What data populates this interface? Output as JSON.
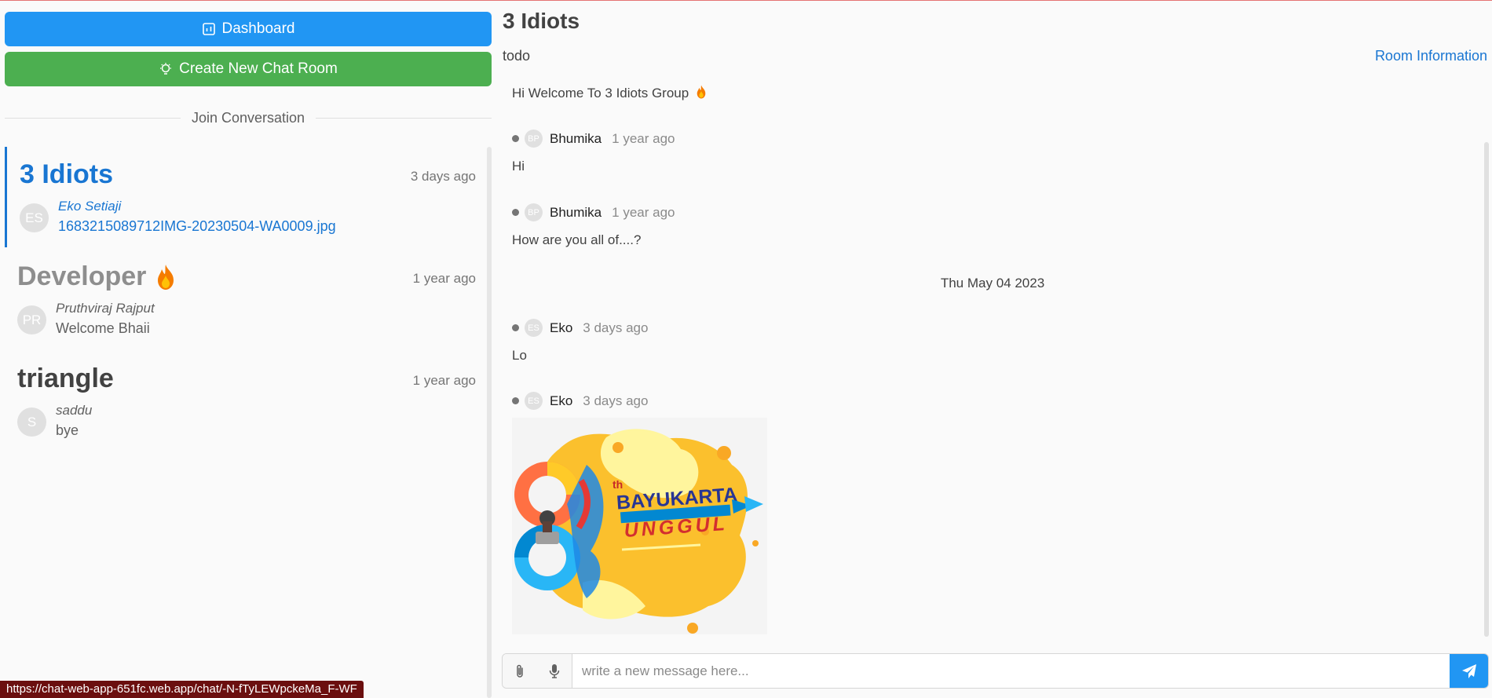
{
  "sidebar": {
    "dashboard_label": "Dashboard",
    "create_room_label": "Create New Chat Room",
    "join_label": "Join Conversation",
    "rooms": [
      {
        "title": "3 Idiots",
        "time": "3 days ago",
        "avatar": "ES",
        "sender": "Eko Setiaji",
        "message": "1683215089712IMG-20230504-WA0009.jpg"
      },
      {
        "title": "Developer",
        "time": "1 year ago",
        "avatar": "PR",
        "sender": "Pruthviraj Rajput",
        "message": "Welcome Bhaii",
        "emoji": "fire-icon"
      },
      {
        "title": "triangle",
        "time": "1 year ago",
        "avatar": "S",
        "sender": "saddu",
        "message": "bye"
      }
    ]
  },
  "chat": {
    "title": "3 Idiots",
    "subtitle": "todo",
    "room_info_label": "Room Information",
    "welcome": "Hi Welcome To 3 Idiots Group",
    "date_separator": "Thu May 04 2023",
    "messages": [
      {
        "avatar": "BP",
        "name": "Bhumika",
        "time": "1 year ago",
        "text": "Hi"
      },
      {
        "avatar": "BP",
        "name": "Bhumika",
        "time": "1 year ago",
        "text": "How are you all of....?"
      },
      {
        "avatar": "ES",
        "name": "Eko",
        "time": "3 days ago",
        "text": "Lo"
      },
      {
        "avatar": "ES",
        "name": "Eko",
        "time": "3 days ago",
        "text": ""
      }
    ],
    "image_text": {
      "ordinal": "th",
      "line1": "BAYUKARTA",
      "line2": "UNGGUL"
    },
    "composer_placeholder": "write a new message here..."
  },
  "status_url": "https://chat-web-app-651fc.web.app/chat/-N-fTyLEWpckeMa_F-WF",
  "colors": {
    "primary": "#2196f3",
    "success": "#4caf50",
    "accent": "#1976d2"
  }
}
